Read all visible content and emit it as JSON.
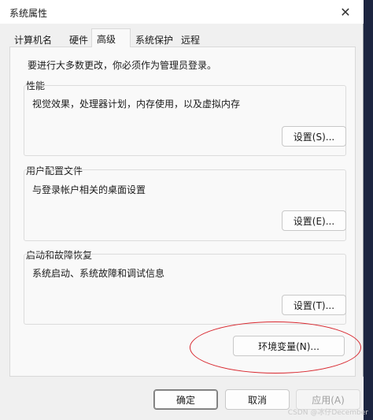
{
  "window": {
    "title": "系统属性",
    "close_glyph": "✕"
  },
  "tabs": [
    {
      "label": "计算机名"
    },
    {
      "label": "硬件"
    },
    {
      "label": "高级"
    },
    {
      "label": "系统保护"
    },
    {
      "label": "远程"
    }
  ],
  "notice": "要进行大多数更改，你必须作为管理员登录。",
  "performance": {
    "label": "性能",
    "description": "视觉效果，处理器计划，内存使用，以及虚拟内存",
    "button": "设置(S)..."
  },
  "user_profiles": {
    "label": "用户配置文件",
    "description": "与登录帐户相关的桌面设置",
    "button": "设置(E)..."
  },
  "startup_recovery": {
    "label": "启动和故障恢复",
    "description": "系统启动、系统故障和调试信息",
    "button": "设置(T)..."
  },
  "env_button": "环境变量(N)...",
  "footer": {
    "ok": "确定",
    "cancel": "取消",
    "apply": "应用(A)"
  },
  "watermark": "CSDN @冰仔December",
  "colors": {
    "annotation": "#d8262d"
  }
}
